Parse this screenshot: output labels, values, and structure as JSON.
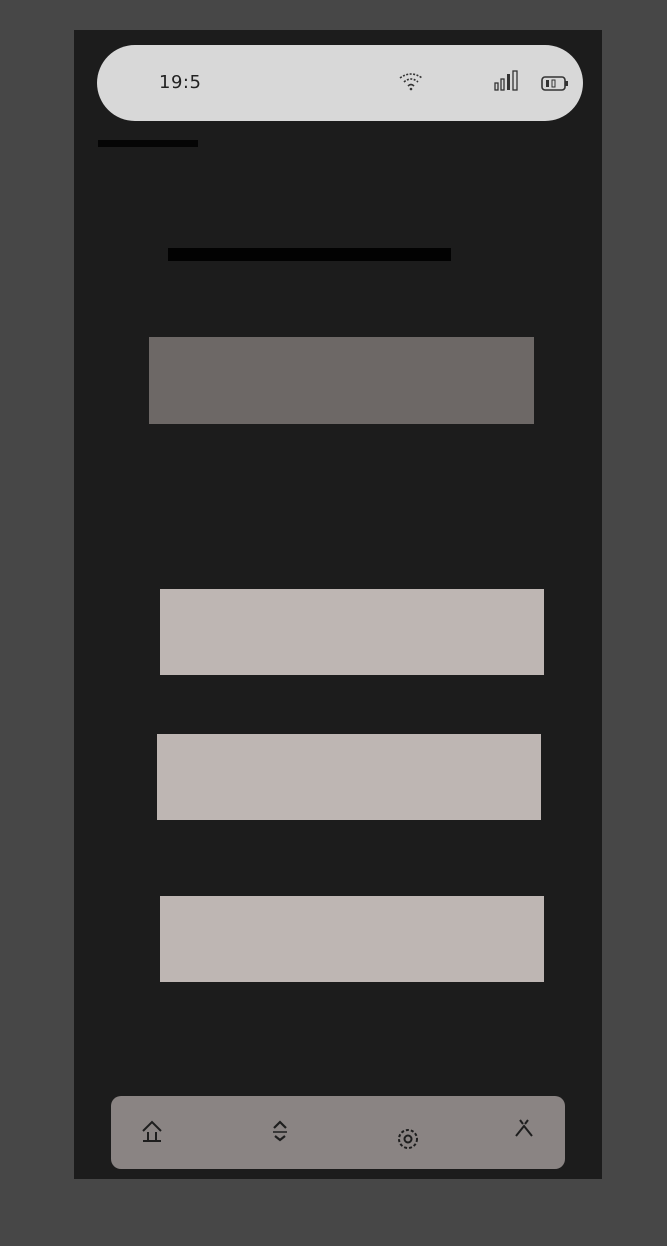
{
  "status_bar": {
    "time": "19:5",
    "icons": [
      "wifi-icon",
      "signal-icon",
      "battery-icon"
    ]
  },
  "nav_bar": {
    "icons": [
      "home-icon",
      "expand-icon",
      "settings-icon",
      "profile-icon"
    ]
  },
  "colors": {
    "page_background": "#474747",
    "screen_background": "#1c1c1c",
    "status_pill": "#d8d8d8",
    "hero_block": "#6d6866",
    "option_block": "#beb6b3",
    "nav_background": "#8a8483"
  }
}
